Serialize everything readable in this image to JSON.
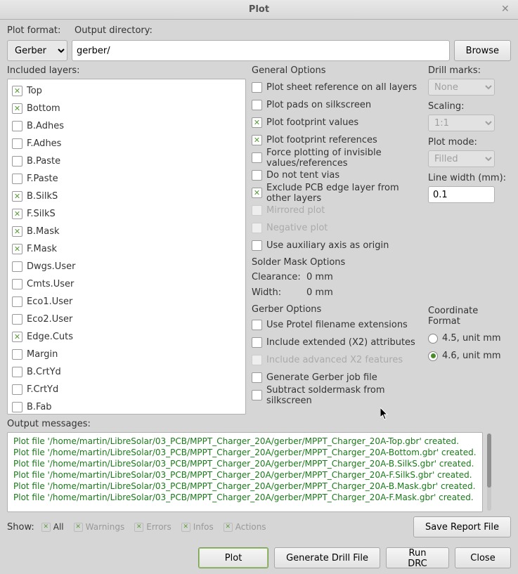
{
  "window": {
    "title": "Plot"
  },
  "labels": {
    "plot_format": "Plot format:",
    "output_dir": "Output directory:",
    "browse": "Browse",
    "included_layers": "Included layers:",
    "general_options": "General Options",
    "drill_marks": "Drill marks:",
    "scaling": "Scaling:",
    "plot_mode": "Plot mode:",
    "line_width": "Line width (mm):",
    "solder_mask": "Solder Mask Options",
    "clearance": "Clearance:",
    "width": "Width:",
    "gerber_options": "Gerber Options",
    "coord_format": "Coordinate Format",
    "output_messages": "Output messages:",
    "show": "Show:",
    "save_report": "Save Report File",
    "plot_btn": "Plot",
    "gen_drill": "Generate Drill File",
    "run_drc": "Run DRC",
    "close": "Close"
  },
  "values": {
    "plot_format": "Gerber",
    "output_dir": "gerber/",
    "drill_marks": "None",
    "scaling": "1:1",
    "plot_mode": "Filled",
    "line_width": "0.1",
    "clearance": "0 mm",
    "soldermask_width": "0 mm"
  },
  "layers": [
    {
      "name": "Top",
      "checked": true
    },
    {
      "name": "Bottom",
      "checked": true
    },
    {
      "name": "B.Adhes",
      "checked": false
    },
    {
      "name": "F.Adhes",
      "checked": false
    },
    {
      "name": "B.Paste",
      "checked": false
    },
    {
      "name": "F.Paste",
      "checked": false
    },
    {
      "name": "B.SilkS",
      "checked": true
    },
    {
      "name": "F.SilkS",
      "checked": true
    },
    {
      "name": "B.Mask",
      "checked": true
    },
    {
      "name": "F.Mask",
      "checked": true
    },
    {
      "name": "Dwgs.User",
      "checked": false
    },
    {
      "name": "Cmts.User",
      "checked": false
    },
    {
      "name": "Eco1.User",
      "checked": false
    },
    {
      "name": "Eco2.User",
      "checked": false
    },
    {
      "name": "Edge.Cuts",
      "checked": true
    },
    {
      "name": "Margin",
      "checked": false
    },
    {
      "name": "B.CrtYd",
      "checked": false
    },
    {
      "name": "F.CrtYd",
      "checked": false
    },
    {
      "name": "B.Fab",
      "checked": false
    }
  ],
  "general_opts": [
    {
      "label": "Plot sheet reference on all layers",
      "checked": false,
      "disabled": false
    },
    {
      "label": "Plot pads on silkscreen",
      "checked": false,
      "disabled": false
    },
    {
      "label": "Plot footprint values",
      "checked": true,
      "disabled": false
    },
    {
      "label": "Plot footprint references",
      "checked": true,
      "disabled": false
    },
    {
      "label": "Force plotting of invisible values/references",
      "checked": false,
      "disabled": false
    },
    {
      "label": "Do not tent vias",
      "checked": false,
      "disabled": false
    },
    {
      "label": "Exclude PCB edge layer from other layers",
      "checked": true,
      "disabled": false
    },
    {
      "label": "Mirrored plot",
      "checked": false,
      "disabled": true
    },
    {
      "label": "Negative plot",
      "checked": false,
      "disabled": true
    },
    {
      "label": "Use auxiliary axis as origin",
      "checked": false,
      "disabled": false
    }
  ],
  "gerber_opts": [
    {
      "label": "Use Protel filename extensions",
      "checked": false,
      "disabled": false
    },
    {
      "label": "Include extended (X2) attributes",
      "checked": false,
      "disabled": false
    },
    {
      "label": "Include advanced X2 features",
      "checked": false,
      "disabled": true
    },
    {
      "label": "Generate Gerber job file",
      "checked": false,
      "disabled": false
    },
    {
      "label": "Subtract soldermask from silkscreen",
      "checked": false,
      "disabled": false
    }
  ],
  "coord_formats": [
    {
      "label": "4.5, unit mm",
      "selected": false
    },
    {
      "label": "4.6, unit mm",
      "selected": true
    }
  ],
  "filters": [
    {
      "label": "All",
      "checked": true,
      "active": true
    },
    {
      "label": "Warnings",
      "checked": true,
      "active": false
    },
    {
      "label": "Errors",
      "checked": true,
      "active": false
    },
    {
      "label": "Infos",
      "checked": true,
      "active": false
    },
    {
      "label": "Actions",
      "checked": true,
      "active": false
    }
  ],
  "messages": [
    "Plot file '/home/martin/LibreSolar/03_PCB/MPPT_Charger_20A/gerber/MPPT_Charger_20A-Top.gbr' created.",
    "Plot file '/home/martin/LibreSolar/03_PCB/MPPT_Charger_20A/gerber/MPPT_Charger_20A-Bottom.gbr' created.",
    "Plot file '/home/martin/LibreSolar/03_PCB/MPPT_Charger_20A/gerber/MPPT_Charger_20A-B.SilkS.gbr' created.",
    "Plot file '/home/martin/LibreSolar/03_PCB/MPPT_Charger_20A/gerber/MPPT_Charger_20A-F.SilkS.gbr' created.",
    "Plot file '/home/martin/LibreSolar/03_PCB/MPPT_Charger_20A/gerber/MPPT_Charger_20A-B.Mask.gbr' created.",
    "Plot file '/home/martin/LibreSolar/03_PCB/MPPT_Charger_20A/gerber/MPPT_Charger_20A-F.Mask.gbr' created."
  ]
}
